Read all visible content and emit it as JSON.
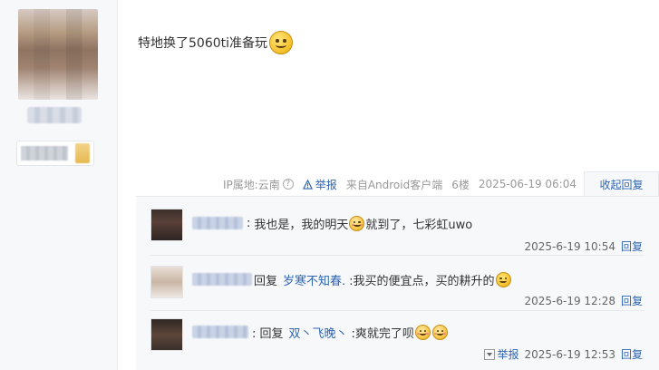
{
  "post": {
    "text": "特地换了5060ti准备玩",
    "ip_location": "IP属地:云南",
    "report_label": "举报",
    "source": "来自Android客户端",
    "floor": "6楼",
    "timestamp": "2025-06-19 06:04",
    "collapse_label": "收起回复"
  },
  "replies": [
    {
      "prefix": ":",
      "text_a": "我也是，我的明天",
      "text_b": "就到了，七彩虹uwo",
      "time": "2025-6-19 10:54",
      "reply_label": "回复"
    },
    {
      "prefix": "回复",
      "target": "岁寒不知春.",
      "text_a": ":我买的便宜点，买的耕升的",
      "time": "2025-6-19 12:28",
      "reply_label": "回复"
    },
    {
      "prefix": ": 回复",
      "target": "双丶飞晚丶",
      "text_a": ":爽就完了呗",
      "time": "2025-6-19 12:53",
      "report_label": "举报",
      "reply_label": "回复"
    }
  ],
  "colors": {
    "link": "#2d64b3",
    "meta": "#999999",
    "panel_bg": "#f7f8fa"
  }
}
